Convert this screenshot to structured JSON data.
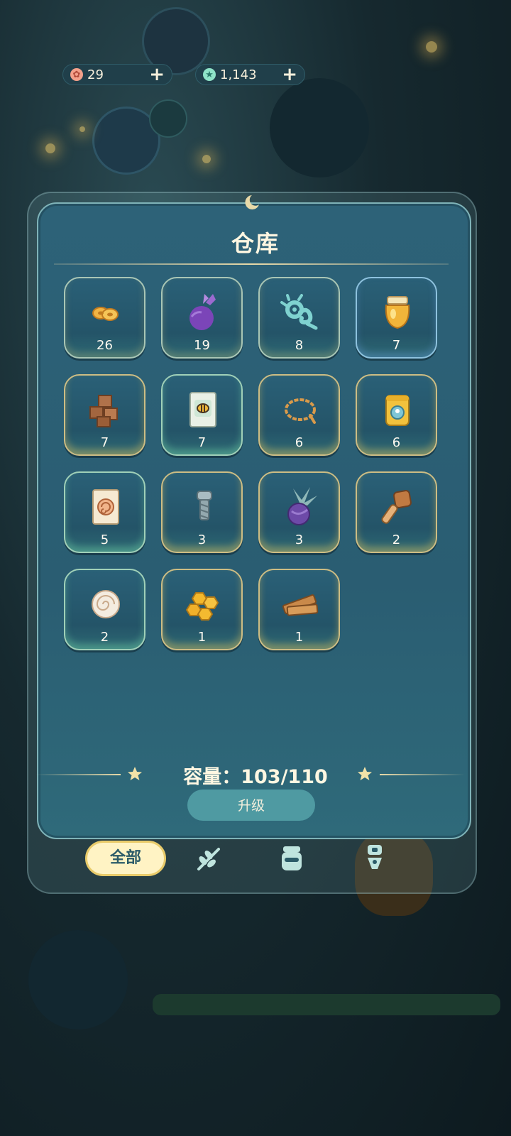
{
  "currencies": [
    {
      "name": "flower-coin",
      "value": "29",
      "color": "#f3a08a"
    },
    {
      "name": "star-gem",
      "value": "1,143",
      "color": "#8fe3c8"
    }
  ],
  "panel": {
    "title": "仓库",
    "capacity_label": "容量：103/110",
    "upgrade_label": "升级"
  },
  "items": [
    {
      "icon": "seeds-icon",
      "count": "26"
    },
    {
      "icon": "purple-turnip-icon",
      "count": "19"
    },
    {
      "icon": "curly-herb-icon",
      "count": "8"
    },
    {
      "icon": "honey-jar-icon",
      "count": "7"
    },
    {
      "icon": "brown-cubes-icon",
      "count": "7"
    },
    {
      "icon": "bee-seed-packet-icon",
      "count": "7"
    },
    {
      "icon": "rope-coil-icon",
      "count": "6"
    },
    {
      "icon": "canned-food-icon",
      "count": "6"
    },
    {
      "icon": "spiral-seed-packet-icon",
      "count": "5"
    },
    {
      "icon": "metal-screw-icon",
      "count": "3"
    },
    {
      "icon": "purple-plant-bulb-icon",
      "count": "3"
    },
    {
      "icon": "wooden-mallet-icon",
      "count": "2"
    },
    {
      "icon": "spiral-shell-icon",
      "count": "2"
    },
    {
      "icon": "honeycomb-icon",
      "count": "1"
    },
    {
      "icon": "wooden-planks-icon",
      "count": "1"
    }
  ],
  "tabs": [
    {
      "name": "tab-all",
      "label": "全部",
      "active": true
    },
    {
      "name": "tab-crops",
      "icon": "branch-icon"
    },
    {
      "name": "tab-goods",
      "icon": "jar-icon"
    },
    {
      "name": "tab-tools",
      "icon": "tool-icon"
    }
  ]
}
